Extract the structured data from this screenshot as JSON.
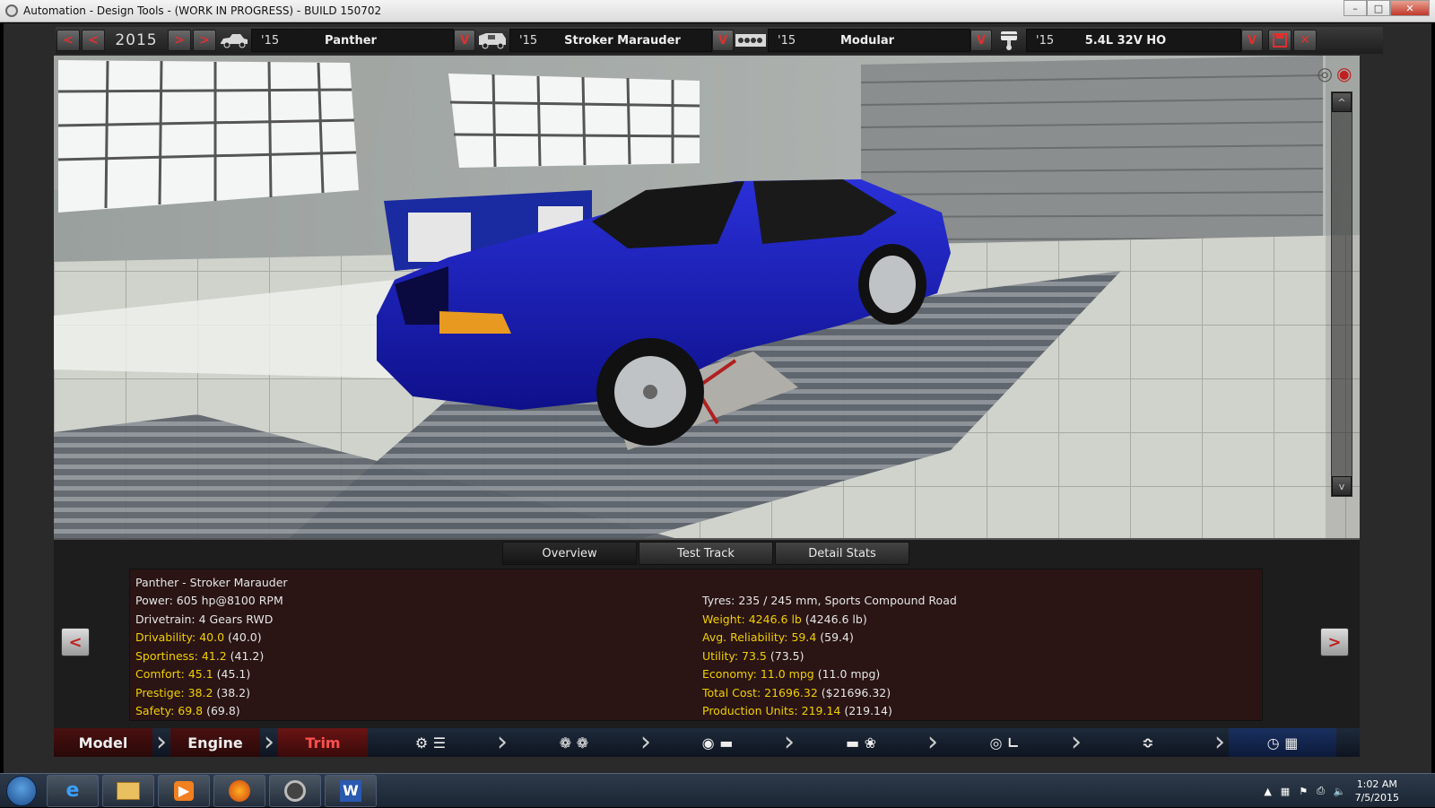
{
  "window": {
    "title": "Automation - Design Tools - (WORK IN PROGRESS) - BUILD 150702"
  },
  "toolbar": {
    "year": "2015",
    "segments": [
      {
        "year": "'15",
        "name": "Panther",
        "icon": "car-model-icon"
      },
      {
        "year": "'15",
        "name": "Stroker Marauder",
        "icon": "trim-van-icon"
      },
      {
        "year": "'15",
        "name": "Modular",
        "icon": "engine-block-icon"
      },
      {
        "year": "'15",
        "name": "5.4L 32V HO",
        "icon": "piston-icon"
      }
    ],
    "dropdown_glyph": "V",
    "prev_glyph": "<",
    "next_glyph": ">"
  },
  "tabs": [
    "Overview",
    "Test Track",
    "Detail Stats"
  ],
  "stats": {
    "title": "Panther - Stroker Marauder",
    "left": [
      {
        "text": "Power: 605 hp@8100 RPM",
        "extra": "",
        "highlight": false
      },
      {
        "text": "Drivetrain: 4 Gears RWD",
        "extra": "",
        "highlight": false
      },
      {
        "text": "Drivability: 40.0",
        "extra": "(40.0)",
        "highlight": true
      },
      {
        "text": "Sportiness: 41.2",
        "extra": "(41.2)",
        "highlight": true
      },
      {
        "text": "Comfort: 45.1",
        "extra": "(45.1)",
        "highlight": true
      },
      {
        "text": "Prestige: 38.2",
        "extra": "(38.2)",
        "highlight": true
      },
      {
        "text": "Safety: 69.8",
        "extra": "(69.8)",
        "highlight": true
      }
    ],
    "right": [
      {
        "text": "Tyres: 235 / 245 mm, Sports Compound Road",
        "extra": "",
        "highlight": false
      },
      {
        "text": "Weight: 4246.6 lb",
        "extra": "(4246.6 lb)",
        "highlight": true
      },
      {
        "text": "Avg. Reliability: 59.4",
        "extra": "(59.4)",
        "highlight": true
      },
      {
        "text": "Utility: 73.5",
        "extra": "(73.5)",
        "highlight": true
      },
      {
        "text": "Economy: 11.0 mpg",
        "extra": "(11.0 mpg)",
        "highlight": true
      },
      {
        "text": "Total Cost: 21696.32",
        "extra": "($21696.32)",
        "highlight": true
      },
      {
        "text": "Production Units: 219.14",
        "extra": "(219.14)",
        "highlight": true
      }
    ]
  },
  "nav": {
    "model": "Model",
    "engine": "Engine",
    "trim": "Trim"
  },
  "taskbar": {
    "time": "1:02 AM",
    "date": "7/5/2015"
  },
  "colors": {
    "car": "#1c1ea8",
    "accent_red": "#e03030",
    "stat_yellow": "#f0d000",
    "panel_red": "#2a1414"
  }
}
